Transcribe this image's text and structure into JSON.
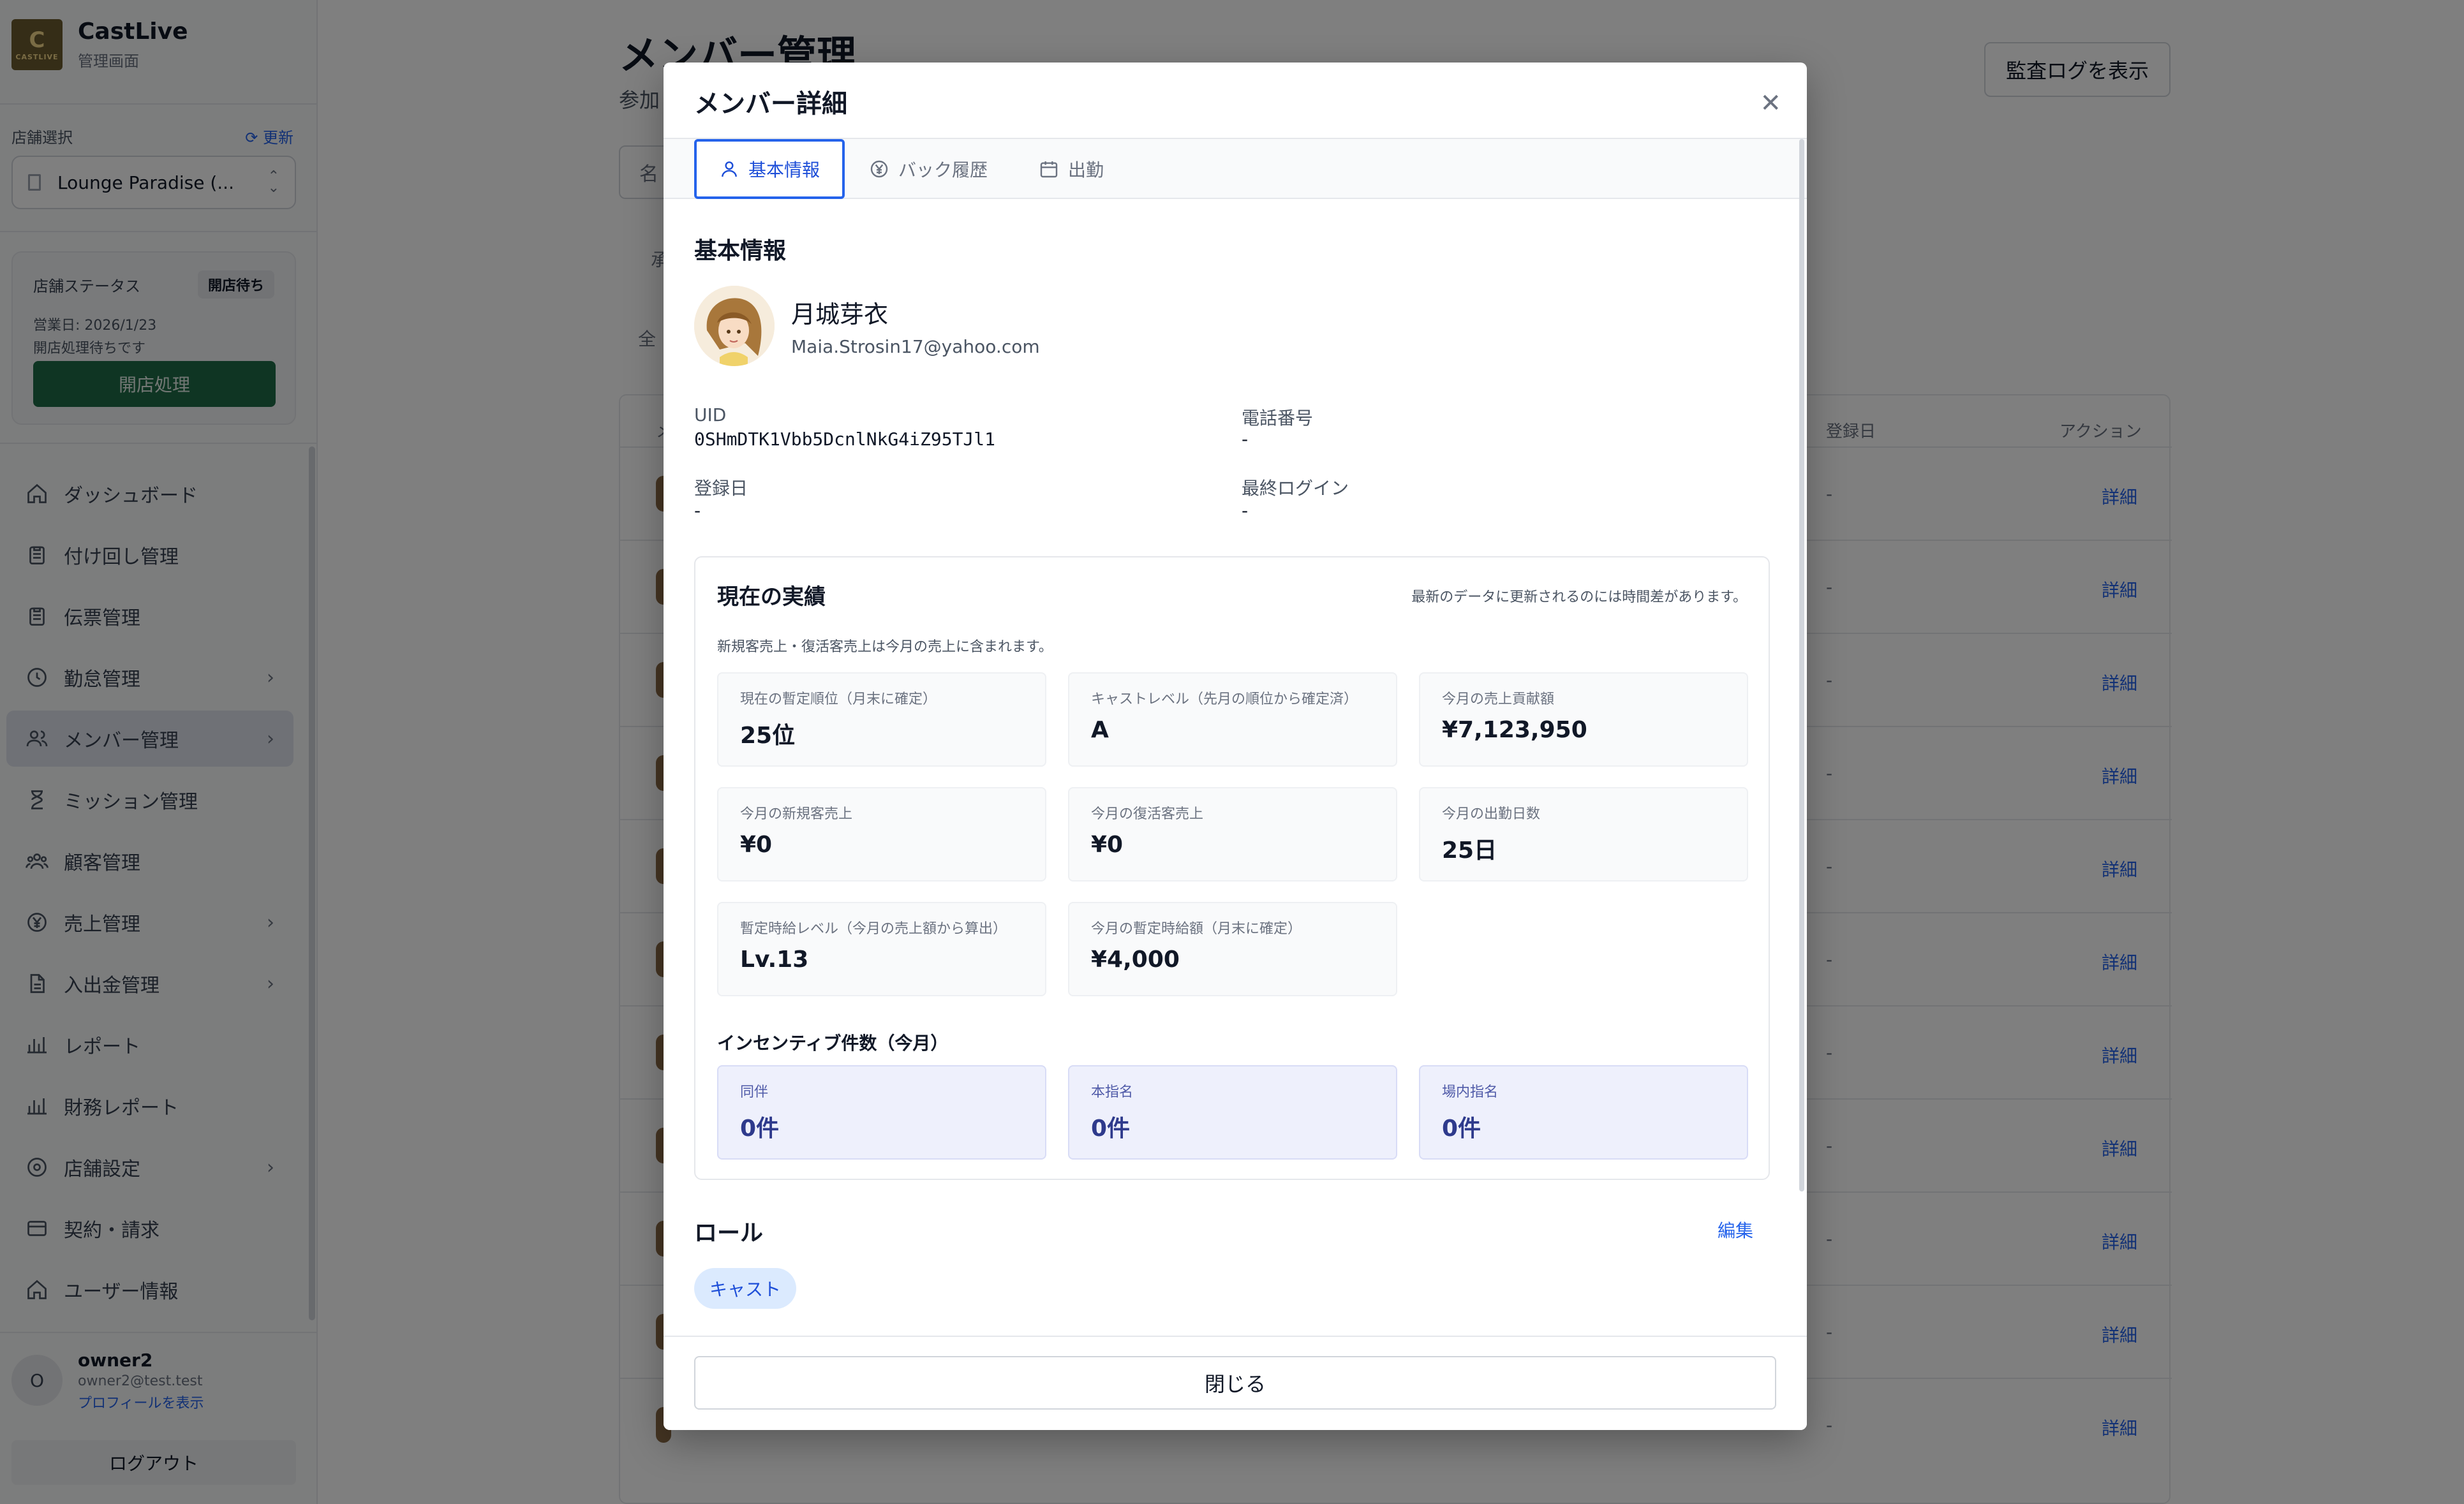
{
  "brand": {
    "name": "CastLive",
    "subtitle": "管理画面",
    "logo_text": "CASTLIVE"
  },
  "store": {
    "label": "店舗選択",
    "refresh_label": "更新",
    "selected": "Lounge Paradise (..."
  },
  "status_card": {
    "title": "店舗ステータス",
    "badge": "開店待ち",
    "business_date": "営業日: 2026/1/23",
    "message": "開店処理待ちです",
    "open_button": "開店処理"
  },
  "nav": [
    {
      "label": "ダッシュボード",
      "icon": "home-icon"
    },
    {
      "label": "付け回し管理",
      "icon": "clipboard-icon"
    },
    {
      "label": "伝票管理",
      "icon": "clipboard-icon"
    },
    {
      "label": "勤怠管理",
      "icon": "clock-icon"
    },
    {
      "label": "メンバー管理",
      "icon": "users-icon"
    },
    {
      "label": "ミッション管理",
      "icon": "hourglass-icon"
    },
    {
      "label": "顧客管理",
      "icon": "customers-icon"
    },
    {
      "label": "売上管理",
      "icon": "yen-icon"
    },
    {
      "label": "入出金管理",
      "icon": "document-icon"
    },
    {
      "label": "レポート",
      "icon": "chart-icon"
    },
    {
      "label": "財務レポート",
      "icon": "chart-icon"
    },
    {
      "label": "店舗設定",
      "icon": "settings-icon"
    },
    {
      "label": "契約・請求",
      "icon": "card-icon"
    },
    {
      "label": "ユーザー情報",
      "icon": "home-icon"
    }
  ],
  "user": {
    "avatar_letter": "O",
    "name": "owner2",
    "email": "owner2@test.test",
    "profile_link": "プロフィールを表示",
    "logout": "ログアウト"
  },
  "main": {
    "title": "メンバー管理",
    "subtitle": "参加",
    "audit_button": "監査ログを表示",
    "search_placeholder": "名",
    "tab_a": "承",
    "tab_b": "全",
    "columns": {
      "name": "メ",
      "registered": "登録日",
      "action": "アクション"
    },
    "rows": [
      {
        "date": "-",
        "action": "詳細"
      },
      {
        "date": "-",
        "action": "詳細"
      },
      {
        "date": "-",
        "action": "詳細"
      },
      {
        "date": "-",
        "action": "詳細"
      },
      {
        "date": "-",
        "action": "詳細"
      },
      {
        "date": "-",
        "action": "詳細"
      },
      {
        "date": "-",
        "action": "詳細"
      },
      {
        "date": "-",
        "action": "詳細"
      },
      {
        "date": "-",
        "action": "詳細"
      },
      {
        "date": "-",
        "action": "詳細"
      },
      {
        "date": "-",
        "action": "詳細"
      }
    ]
  },
  "modal": {
    "title": "メンバー詳細",
    "tabs": [
      {
        "label": "基本情報",
        "icon": "person-icon"
      },
      {
        "label": "バック履歴",
        "icon": "yen-circle-icon"
      },
      {
        "label": "出勤",
        "icon": "calendar-icon"
      }
    ],
    "section_title": "基本情報",
    "profile": {
      "name": "月城芽衣",
      "email": "Maia.Strosin17@yahoo.com"
    },
    "info": {
      "uid_label": "UID",
      "uid_value": "0SHmDTK1Vbb5DcnlNkG4iZ95TJl1",
      "phone_label": "電話番号",
      "phone_value": "-",
      "registered_label": "登録日",
      "registered_value": "-",
      "last_login_label": "最終ログイン",
      "last_login_value": "-"
    },
    "performance": {
      "title": "現在の実績",
      "note": "最新のデータに更新されるのには時間差があります。",
      "sub_note": "新規客売上・復活客売上は今月の売上に含まれます。",
      "kpis": [
        {
          "label": "現在の暫定順位（月末に確定）",
          "value": "25位"
        },
        {
          "label": "キャストレベル（先月の順位から確定済）",
          "value": "A"
        },
        {
          "label": "今月の売上貢献額",
          "value": "¥7,123,950"
        },
        {
          "label": "今月の新規客売上",
          "value": "¥0"
        },
        {
          "label": "今月の復活客売上",
          "value": "¥0"
        },
        {
          "label": "今月の出勤日数",
          "value": "25日"
        },
        {
          "label": "暫定時給レベル（今月の売上額から算出）",
          "value": "Lv.13"
        },
        {
          "label": "今月の暫定時給額（月末に確定）",
          "value": "¥4,000"
        }
      ],
      "incentive_title": "インセンティブ件数（今月）",
      "incentives": [
        {
          "label": "同伴",
          "value": "0件"
        },
        {
          "label": "本指名",
          "value": "0件"
        },
        {
          "label": "場内指名",
          "value": "0件"
        }
      ]
    },
    "role": {
      "title": "ロール",
      "edit": "編集",
      "chip": "キャスト"
    },
    "close_button": "閉じる"
  }
}
